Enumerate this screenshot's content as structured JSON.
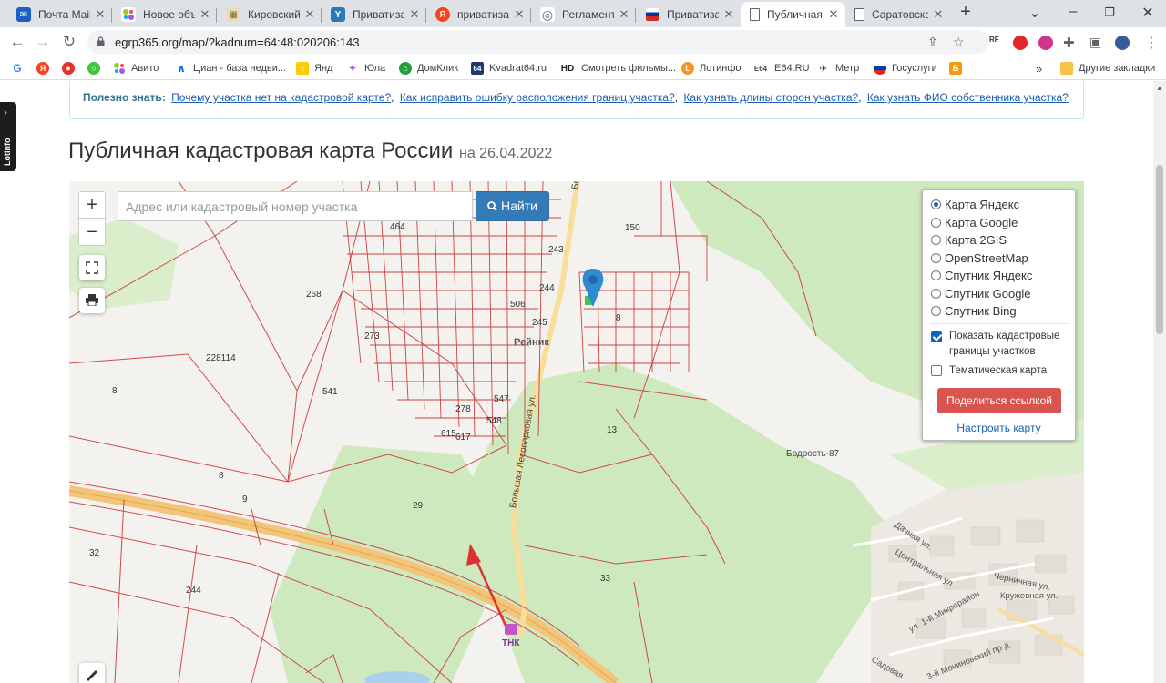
{
  "browser": {
    "tabs": [
      {
        "label": "Почта Mail.r",
        "icon": "mail-icon",
        "color": "#1b5fc4",
        "glyph": "✉"
      },
      {
        "label": "Новое объя",
        "icon": "avito-icon",
        "color": "#97cf26",
        "glyph": "•"
      },
      {
        "label": "Кировский",
        "icon": "building-icon",
        "color": "#c0a060",
        "glyph": "▦"
      },
      {
        "label": "Приватизац",
        "icon": "document-icon",
        "color": "#2a7ab8",
        "glyph": "Y"
      },
      {
        "label": "приватизац",
        "icon": "yandex-icon",
        "color": "#fc3f1d",
        "glyph": "Я"
      },
      {
        "label": "Регламент-",
        "icon": "globe-icon",
        "color": "#5f6368",
        "glyph": "◎"
      },
      {
        "label": "Приватизац",
        "icon": "flag-icon",
        "color": "#d52b1e",
        "glyph": "▬"
      },
      {
        "label": "Публичная",
        "icon": "page-icon",
        "color": "#ffffff",
        "glyph": "▯"
      },
      {
        "label": "Саратовска",
        "icon": "page-icon",
        "color": "#ffffff",
        "glyph": "▯"
      }
    ],
    "active_tab": 7,
    "url": "egrp365.org/map/?kadnum=64:48:020206:143"
  },
  "bookmarks": [
    {
      "label": "",
      "icon": "google-icon",
      "color": "#4285f4",
      "glyph": "G"
    },
    {
      "label": "",
      "icon": "yandex-icon",
      "color": "#fc3f1d",
      "glyph": "Я"
    },
    {
      "label": "",
      "icon": "maps-pin-icon",
      "color": "#e5322d",
      "glyph": "●"
    },
    {
      "label": "",
      "icon": "circle-icon",
      "color": "#3ec73e",
      "glyph": "◯"
    },
    {
      "label": "Авито",
      "icon": "avito-icon",
      "color": "#97cf26",
      "glyph": "•"
    },
    {
      "label": "Циан - база недви...",
      "icon": "cian-icon",
      "color": "#0468ff",
      "glyph": "∧"
    },
    {
      "label": "Янд",
      "icon": "house-icon",
      "color": "#ffcc00",
      "glyph": "⌂"
    },
    {
      "label": "Юла",
      "icon": "yula-icon",
      "color": "#b55aff",
      "glyph": "✦"
    },
    {
      "label": "ДомКлик",
      "icon": "domclick-icon",
      "color": "#21a038",
      "glyph": "⌂"
    },
    {
      "label": "Kvadrat64.ru",
      "icon": "kvadrat-icon",
      "color": "#1e3a6b",
      "glyph": "64"
    },
    {
      "label": "Смотреть фильмы...",
      "icon": "hd-icon",
      "color": "#222222",
      "glyph": "HD"
    },
    {
      "label": "Лотинфо",
      "icon": "lotinfo-icon",
      "color": "#f7941d",
      "glyph": "L"
    },
    {
      "label": "E64.RU",
      "icon": "e64-icon",
      "color": "#444444",
      "glyph": "E"
    },
    {
      "label": "Метр",
      "icon": "metr-icon",
      "color": "#1e3a6b",
      "glyph": "✈"
    },
    {
      "label": "Госуслуги",
      "icon": "gosuslugi-icon",
      "color": "#d52b1e",
      "glyph": "●"
    },
    {
      "label": "",
      "icon": "bookmark-b-icon",
      "color": "#f39c12",
      "glyph": "Б"
    }
  ],
  "bookmarks_other": "Другие закладки",
  "lotinfo_label": "Lotinfo",
  "info": {
    "prefix": "Полезно знать:",
    "links": [
      "Почему участка нет на кадастровой карте?",
      "Как исправить ошибку расположения границ участка?",
      "Как узнать длины сторон участка?",
      "Как узнать ФИО собственника участка?"
    ]
  },
  "title": "Публичная кадастровая карта России",
  "title_date": "на 26.04.2022",
  "map": {
    "search_placeholder": "Адрес или кадастровый номер участка",
    "find_label": "Найти",
    "zoom_in": "+",
    "zoom_out": "−",
    "layers": [
      {
        "label": "Карта Яндекс",
        "selected": true
      },
      {
        "label": "Карта Google",
        "selected": false
      },
      {
        "label": "Карта 2GIS",
        "selected": false
      },
      {
        "label": "OpenStreetMap",
        "selected": false
      },
      {
        "label": "Спутник Яндекс",
        "selected": false
      },
      {
        "label": "Спутник Google",
        "selected": false
      },
      {
        "label": "Спутник Bing",
        "selected": false
      }
    ],
    "show_borders": {
      "label_1": "Показать кадастровые",
      "label_2": "границы участков",
      "checked": true
    },
    "thematic": {
      "label": "Тематическая карта",
      "checked": false
    },
    "share_label": "Поделиться ссылкой",
    "configure_label": "Настроить карту",
    "parcel_numbers": [
      "150",
      "268",
      "228114",
      "8",
      "541",
      "273",
      "464",
      "506",
      "244",
      "243",
      "245",
      "547",
      "278",
      "548",
      "615",
      "617",
      "13",
      "29",
      "8",
      "9",
      "32",
      "244",
      "33",
      "8"
    ],
    "places": [
      "Рейник",
      "Бодрость-87",
      "ТНК",
      "Больш",
      "Большая Лесопарковая ул."
    ],
    "streets": [
      "Дачная ул.",
      "Центральная ул.",
      "Черничная ул.",
      "Кружевная ул.",
      "ул. 1-й Микрорайон",
      "3-й Мочиновский пр-д",
      "Садовая"
    ]
  }
}
